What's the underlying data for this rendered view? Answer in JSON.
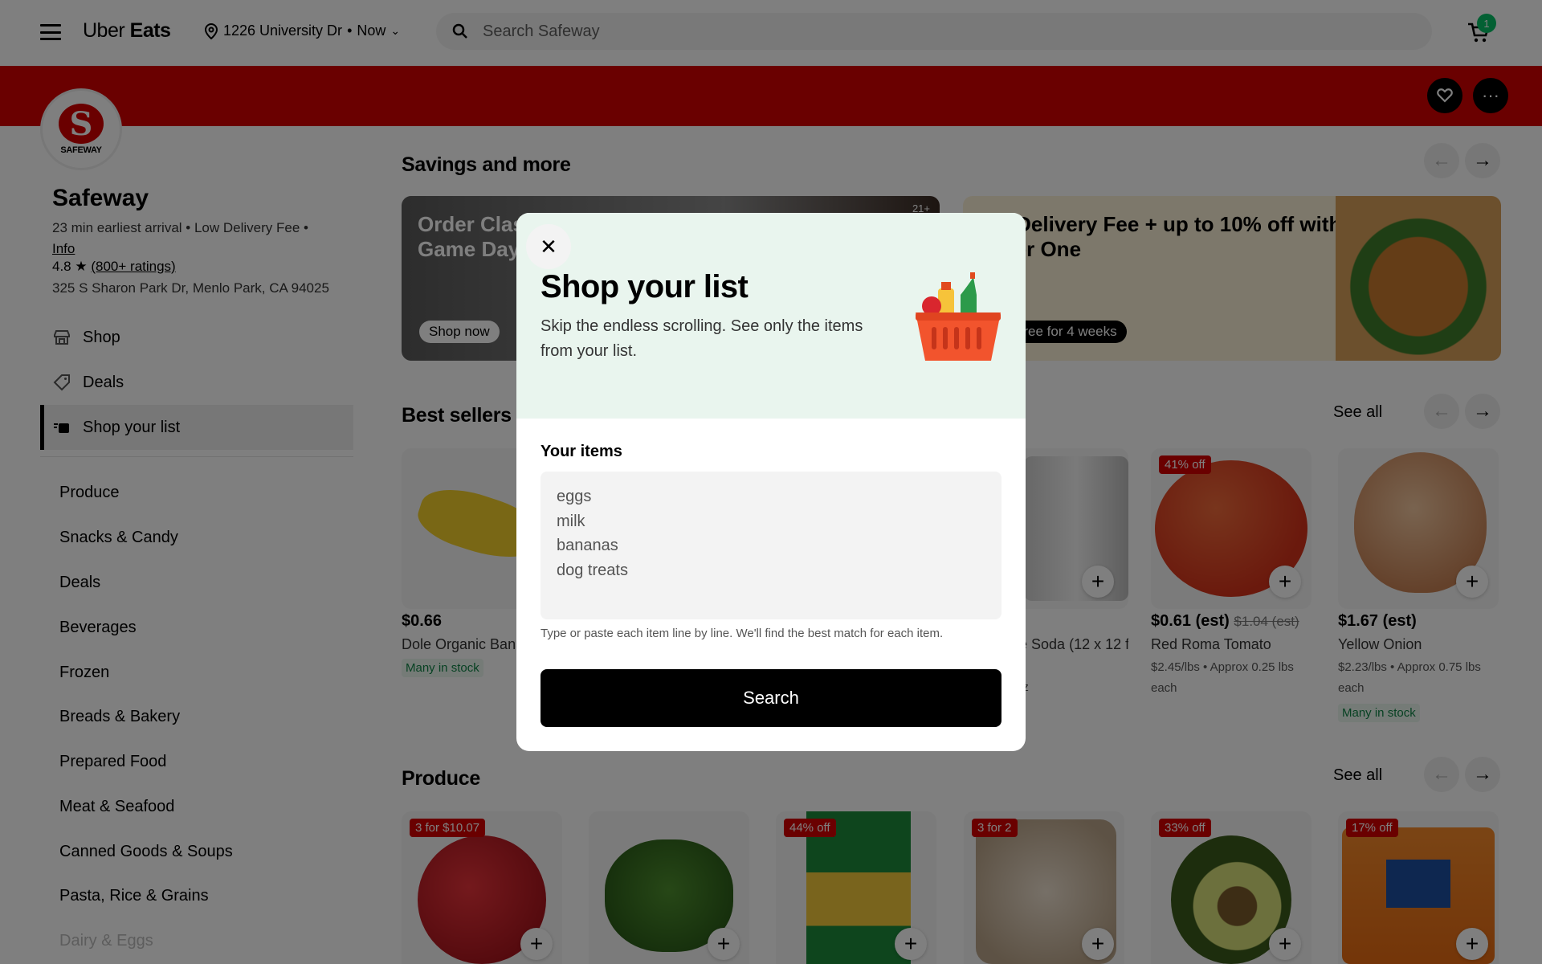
{
  "header": {
    "logo_light": "Uber",
    "logo_bold": "Eats",
    "address": "1226 University Dr",
    "time": "Now",
    "search_placeholder": "Search Safeway",
    "cart_count": "1"
  },
  "store": {
    "logo_text": "SAFEWAY",
    "name": "Safeway",
    "meta": "23 min earliest arrival • Low Delivery Fee •",
    "info_link": "Info",
    "rating": "4.8",
    "rating_count": "(800+ ratings)",
    "address": "325 S Sharon Park Dr, Menlo Park, CA 94025"
  },
  "sidebar": {
    "nav": [
      {
        "label": "Shop"
      },
      {
        "label": "Deals"
      },
      {
        "label": "Shop your list"
      }
    ],
    "categories": [
      "Produce",
      "Snacks & Candy",
      "Deals",
      "Beverages",
      "Frozen",
      "Breads & Bakery",
      "Prepared Food",
      "Meat & Seafood",
      "Canned Goods & Soups",
      "Pasta, Rice & Grains",
      "Dairy & Eggs"
    ]
  },
  "main": {
    "savings_title": "Savings and more",
    "promo1_text": "Order Classics for Game Day",
    "promo1_cta": "Shop now",
    "promo1_age": "21+",
    "promo2_text": "$0 Delivery Fee + up to 10% off with Uber One",
    "promo2_cta": "Try free for 4 weeks",
    "best_sellers_title": "Best sellers",
    "see_all": "See all",
    "produce_title": "Produce",
    "best_sellers": [
      {
        "price": "$0.66",
        "name": "Dole Organic Bananas",
        "stock": "Many in stock"
      },
      {
        "name": "Diet Coke Soda (12 x 12 fl oz)",
        "detail": "12 x 12 fl oz"
      },
      {
        "badge": "41% off",
        "price": "$0.61 (est)",
        "old_price": "$1.04 (est)",
        "name": "Red Roma Tomato",
        "detail": "$2.45/lbs • Approx 0.25 lbs each"
      },
      {
        "price": "$1.67 (est)",
        "name": "Yellow Onion",
        "detail": "$2.23/lbs • Approx 0.75 lbs each",
        "stock": "Many in stock"
      }
    ],
    "produce_badges": [
      "3 for $10.07",
      "44% off",
      "3 for 2",
      "33% off",
      "17% off"
    ]
  },
  "modal": {
    "title": "Shop your list",
    "subtitle": "Skip the endless scrolling. See only the items from your list.",
    "items_label": "Your items",
    "items_value": "eggs\nmilk\nbananas\ndog treats",
    "hint": "Type or paste each item line by line. We'll find the best match for each item.",
    "search_label": "Search"
  },
  "colors": {
    "brand_red": "#d40000",
    "uber_green": "#06c167",
    "modal_header": "#e9f5ee"
  }
}
